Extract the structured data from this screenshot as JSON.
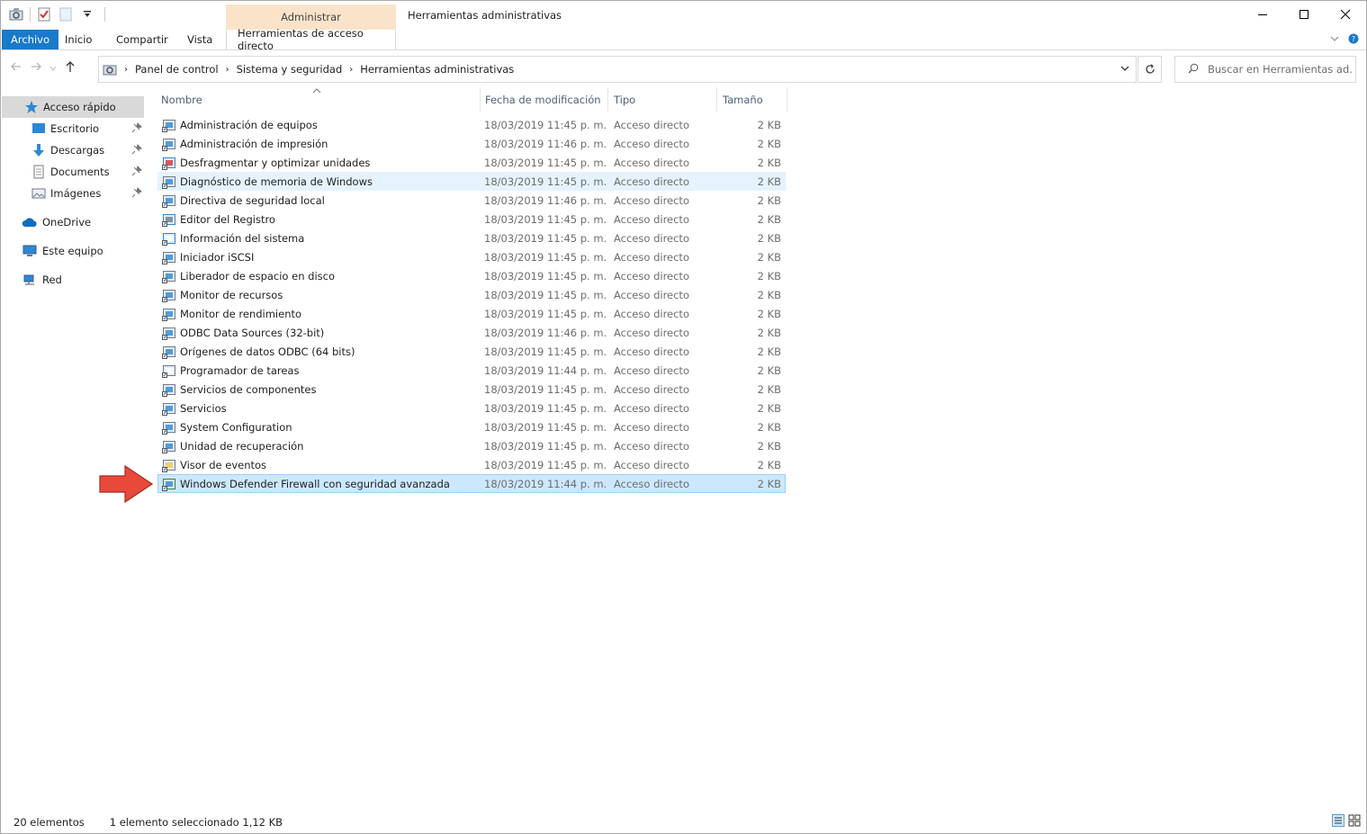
{
  "titlebar": {
    "context_group": "Administrar",
    "window_title": "Herramientas administrativas"
  },
  "ribbon": {
    "tabs": [
      "Archivo",
      "Inicio",
      "Compartir",
      "Vista"
    ],
    "context_tab": "Herramientas de acceso directo"
  },
  "address": {
    "crumbs": [
      "Panel de control",
      "Sistema y seguridad",
      "Herramientas administrativas"
    ]
  },
  "search": {
    "placeholder": "Buscar en Herramientas ad..."
  },
  "sidebar": {
    "quick_access": "Acceso rápido",
    "pinned": [
      "Escritorio",
      "Descargas",
      "Documents",
      "Imágenes"
    ],
    "onedrive": "OneDrive",
    "this_pc": "Este equipo",
    "network": "Red"
  },
  "columns": {
    "name": "Nombre",
    "date": "Fecha de modificación",
    "type": "Tipo",
    "size": "Tamaño"
  },
  "files": [
    {
      "name": "Administración de equipos",
      "date": "18/03/2019 11:45 p. m.",
      "type": "Acceso directo",
      "size": "2 KB",
      "icon": "computer-management-icon"
    },
    {
      "name": "Administración de impresión",
      "date": "18/03/2019 11:46 p. m.",
      "type": "Acceso directo",
      "size": "2 KB",
      "icon": "print-management-icon"
    },
    {
      "name": "Desfragmentar y optimizar unidades",
      "date": "18/03/2019 11:45 p. m.",
      "type": "Acceso directo",
      "size": "2 KB",
      "icon": "defrag-icon"
    },
    {
      "name": "Diagnóstico de memoria de Windows",
      "date": "18/03/2019 11:45 p. m.",
      "type": "Acceso directo",
      "size": "2 KB",
      "icon": "memory-diagnostic-icon"
    },
    {
      "name": "Directiva de seguridad local",
      "date": "18/03/2019 11:46 p. m.",
      "type": "Acceso directo",
      "size": "2 KB",
      "icon": "security-policy-icon"
    },
    {
      "name": "Editor del Registro",
      "date": "18/03/2019 11:45 p. m.",
      "type": "Acceso directo",
      "size": "2 KB",
      "icon": "registry-editor-icon"
    },
    {
      "name": "Información del sistema",
      "date": "18/03/2019 11:45 p. m.",
      "type": "Acceso directo",
      "size": "2 KB",
      "icon": "system-info-icon"
    },
    {
      "name": "Iniciador iSCSI",
      "date": "18/03/2019 11:45 p. m.",
      "type": "Acceso directo",
      "size": "2 KB",
      "icon": "iscsi-icon"
    },
    {
      "name": "Liberador de espacio en disco",
      "date": "18/03/2019 11:45 p. m.",
      "type": "Acceso directo",
      "size": "2 KB",
      "icon": "disk-cleanup-icon"
    },
    {
      "name": "Monitor de recursos",
      "date": "18/03/2019 11:45 p. m.",
      "type": "Acceso directo",
      "size": "2 KB",
      "icon": "resource-monitor-icon"
    },
    {
      "name": "Monitor de rendimiento",
      "date": "18/03/2019 11:45 p. m.",
      "type": "Acceso directo",
      "size": "2 KB",
      "icon": "performance-monitor-icon"
    },
    {
      "name": "ODBC Data Sources (32-bit)",
      "date": "18/03/2019 11:46 p. m.",
      "type": "Acceso directo",
      "size": "2 KB",
      "icon": "odbc-icon"
    },
    {
      "name": "Orígenes de datos ODBC (64 bits)",
      "date": "18/03/2019 11:45 p. m.",
      "type": "Acceso directo",
      "size": "2 KB",
      "icon": "odbc-icon"
    },
    {
      "name": "Programador de tareas",
      "date": "18/03/2019 11:44 p. m.",
      "type": "Acceso directo",
      "size": "2 KB",
      "icon": "task-scheduler-icon"
    },
    {
      "name": "Servicios de componentes",
      "date": "18/03/2019 11:45 p. m.",
      "type": "Acceso directo",
      "size": "2 KB",
      "icon": "component-services-icon"
    },
    {
      "name": "Servicios",
      "date": "18/03/2019 11:45 p. m.",
      "type": "Acceso directo",
      "size": "2 KB",
      "icon": "services-icon"
    },
    {
      "name": "System Configuration",
      "date": "18/03/2019 11:45 p. m.",
      "type": "Acceso directo",
      "size": "2 KB",
      "icon": "system-configuration-icon"
    },
    {
      "name": "Unidad de recuperación",
      "date": "18/03/2019 11:45 p. m.",
      "type": "Acceso directo",
      "size": "2 KB",
      "icon": "recovery-drive-icon"
    },
    {
      "name": "Visor de eventos",
      "date": "18/03/2019 11:45 p. m.",
      "type": "Acceso directo",
      "size": "2 KB",
      "icon": "event-viewer-icon"
    },
    {
      "name": "Windows Defender Firewall con seguridad avanzada",
      "date": "18/03/2019 11:44 p. m.",
      "type": "Acceso directo",
      "size": "2 KB",
      "icon": "firewall-icon"
    }
  ],
  "hover_index": 3,
  "selected_index": 19,
  "status": {
    "count": "20 elementos",
    "selection": "1 elemento seleccionado  1,12 KB"
  },
  "colors": {
    "file_tab": "#1979ca",
    "context_header": "#fbe3c9",
    "selection": "#cce8ff",
    "hover": "#e5f3ff",
    "arrow": "#e8493b"
  }
}
